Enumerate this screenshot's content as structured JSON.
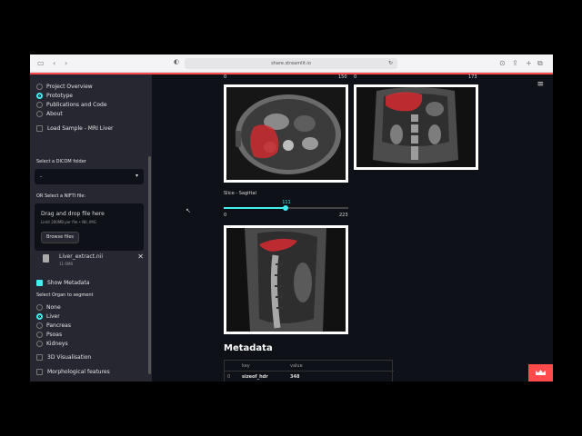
{
  "browser": {
    "url": "share.streamlit.io",
    "icons": [
      "sidebar-icon",
      "back-icon",
      "forward-icon",
      "shield-icon",
      "lock-icon",
      "reload-icon",
      "download-icon",
      "share-icon",
      "new-tab-icon",
      "tabs-icon"
    ]
  },
  "sidebar": {
    "nav": [
      {
        "label": "Project Overview",
        "selected": false
      },
      {
        "label": "Prototype",
        "selected": true
      },
      {
        "label": "Publications and Code",
        "selected": false
      },
      {
        "label": "About",
        "selected": false
      }
    ],
    "load_sample": {
      "label": "Load Sample - MRI Liver",
      "checked": false
    },
    "dicom_label": "Select a DICOM folder",
    "dicom_value": "-",
    "nifti_label": "OR Select a NIFTI file:",
    "dropzone": {
      "title": "Drag and drop file here",
      "limit": "Limit 200MB per file • NII, IMG",
      "browse": "Browse files"
    },
    "file": {
      "name": "Liver_extract.nii",
      "size": "11.6MB"
    },
    "show_metadata": {
      "label": "Show Metadata",
      "checked": true
    },
    "organ_label": "Select Organ to segment",
    "organs": [
      {
        "label": "None",
        "selected": false
      },
      {
        "label": "Liver",
        "selected": true
      },
      {
        "label": "Pancreas",
        "selected": false
      },
      {
        "label": "Psoas",
        "selected": false
      },
      {
        "label": "Kidneys",
        "selected": false
      }
    ],
    "vis3d": {
      "label": "3D Visualisation",
      "checked": false
    },
    "morph": {
      "label": "Morphological features",
      "checked": false
    }
  },
  "main": {
    "top_slider_labels": {
      "a_min": "0",
      "a_max": "150",
      "b_min": "0",
      "b_max": "173"
    },
    "sagittal_slider": {
      "title": "Slice - Sagittal",
      "value": "111",
      "min": "0",
      "max": "223",
      "fraction": 0.4978
    },
    "metadata": {
      "heading": "Metadata",
      "columns": [
        "key",
        "value"
      ],
      "rows": [
        {
          "index": "0",
          "key": "sizeof_hdr",
          "value": "348"
        }
      ]
    }
  },
  "colors": {
    "accent": "#ff4b4b",
    "slider": "#44eeee",
    "segmentation": "#e0242a"
  }
}
